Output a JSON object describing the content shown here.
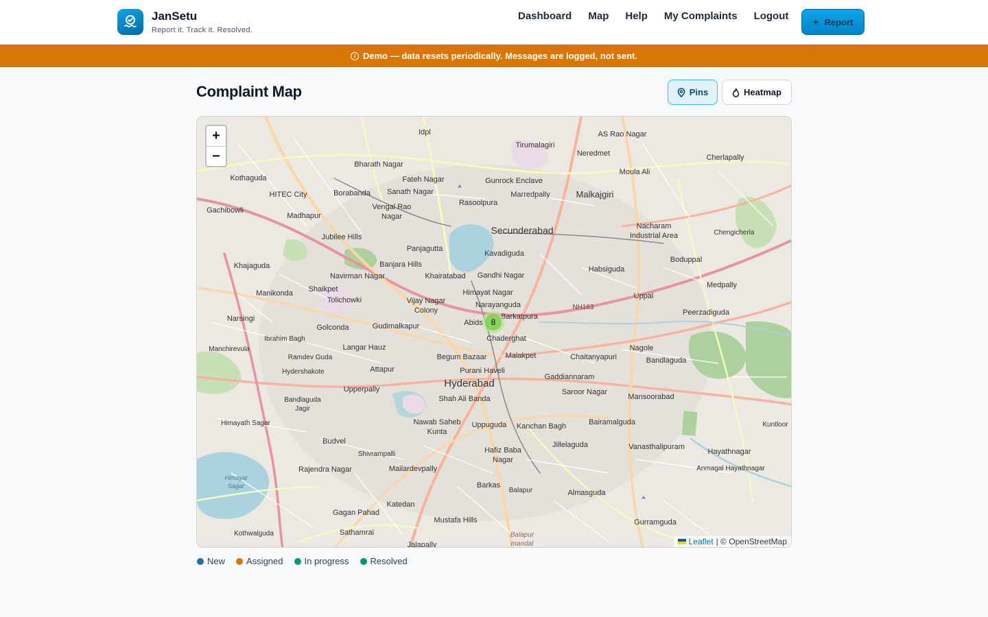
{
  "header": {
    "brand_name": "JanSetu",
    "tagline": "Report it. Track it. Resolved.",
    "nav": [
      "Dashboard",
      "Map",
      "Help",
      "My Complaints",
      "Logout"
    ],
    "report_label": "Report",
    "report_icon": "plus-icon"
  },
  "banner": {
    "text": "Demo — data resets periodically. Messages are logged, not sent.",
    "icon": "info-icon"
  },
  "page": {
    "title": "Complaint Map",
    "view_toggle": {
      "pins_label": "Pins",
      "heatmap_label": "Heatmap",
      "active": "Pins"
    }
  },
  "map": {
    "zoom_in": "+",
    "zoom_out": "−",
    "cluster_count": "8",
    "attribution_link": "Leaflet",
    "attribution_text": "| © OpenStreetMap",
    "labels": [
      "Idpl",
      "Tirumalagiri",
      "AS Rao Nagar",
      "Neredmet",
      "Cherlapally",
      "Bharath Nagar",
      "Fateh Nagar",
      "Gunrock Enclave",
      "Moula Ali",
      "Kothaguda",
      "HITEC City",
      "Borabanda",
      "Sanath Nagar",
      "Marredpally",
      "Malkajgiri",
      "Rasoolpura",
      "Gachibowli",
      "Madhapur",
      "Vengal Rao Nagar",
      "Secunderabad",
      "Nacharam Industrial Area",
      "Chengicherla",
      "Jubilee Hills",
      "Panjagutta",
      "Kavadiguda",
      "Boduppal",
      "Khajaguda",
      "Banjara Hills",
      "Habsiguda",
      "Navirman Nagar",
      "Khairatabad",
      "Gandhi Nagar",
      "Medpally",
      "Manikonda",
      "Shaikpet",
      "Himayat Nagar",
      "Uppal",
      "Tolichowki",
      "Vijay Nagar Colony",
      "Narayanguda",
      "NH163",
      "Narsingi",
      "Barkatpura",
      "Peerzadiguda",
      "Golconda",
      "Gudimalkapur",
      "Abids",
      "Chaderghat",
      "Ibrahim Bagh",
      "Nagole",
      "Manchirevula",
      "Langar Hauz",
      "Ramdev Guda",
      "Begum Bazaar",
      "Malakpet",
      "Chaitanyapuri",
      "Bandlaguda",
      "Hydershakote",
      "Attapur",
      "Purani Haveli",
      "Gaddiannaram",
      "Hyderabad",
      "Upperpally",
      "Saroor Nagar",
      "Shah Ali Banda",
      "Mansoorabad",
      "Bandlaguda Jagir",
      "Nawab Saheb Kunta",
      "Uppuguda",
      "Kanchan Bagh",
      "Bairamalguda",
      "Himayath Sagar",
      "Kuntloor",
      "Budvel",
      "Jillelaguda",
      "Vanasthalipuram",
      "Hafiz Baba Nagar",
      "Hayathnagar",
      "Shivrampalli",
      "Rajendra Nagar",
      "Mailardevpally",
      "Anmagal Hayathnagar",
      "Himayat Sagar",
      "Barkas",
      "Balapur",
      "Almasguda",
      "Katedan",
      "Gagan Pahad",
      "Gurramguda",
      "Mustafa Hills",
      "Kothwalguda",
      "Sathamrai",
      "Balapur mandal",
      "Jalapally"
    ]
  },
  "legend": [
    {
      "label": "New",
      "color": "#1d6fa5"
    },
    {
      "label": "Assigned",
      "color": "#d97706"
    },
    {
      "label": "In progress",
      "color": "#0d9488"
    },
    {
      "label": "Resolved",
      "color": "#059669"
    }
  ]
}
